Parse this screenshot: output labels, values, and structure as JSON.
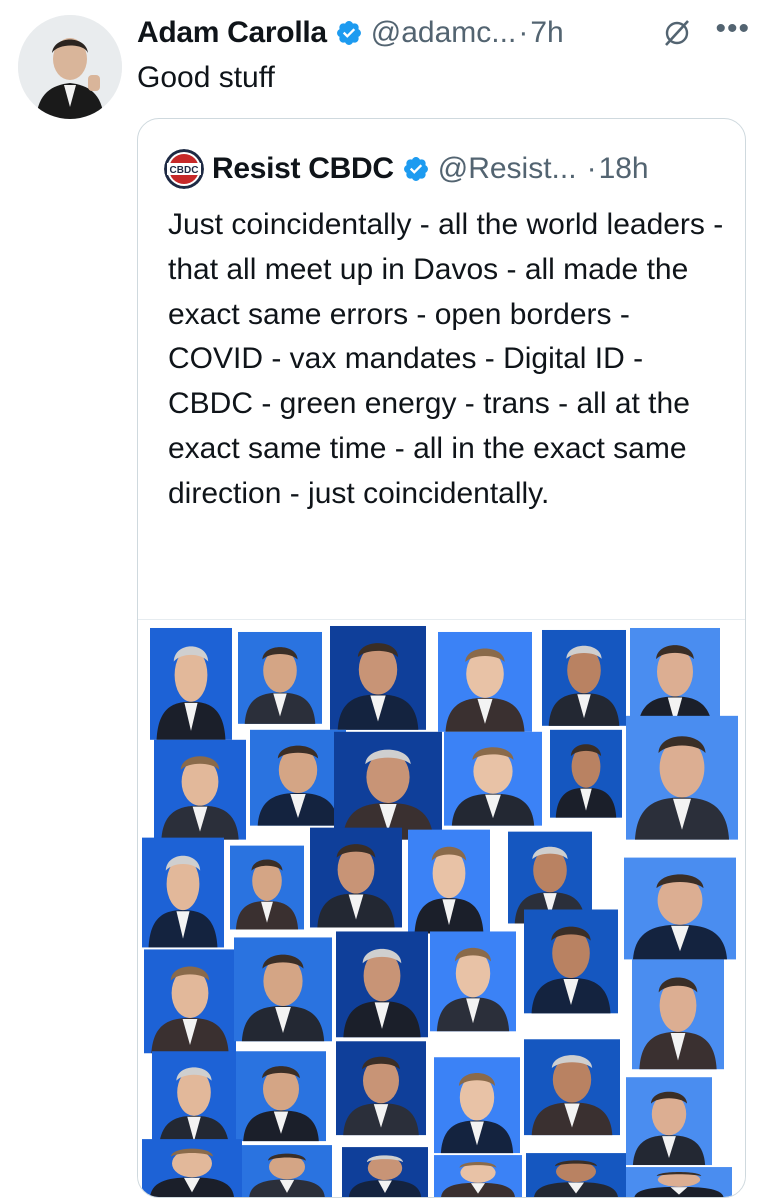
{
  "tweet": {
    "author_name": "Adam Carolla",
    "handle": "@adamc...",
    "separator": "·",
    "time": "7h",
    "text": "Good stuff",
    "more_icon": "more-dots-icon",
    "grok_icon": "grok-icon"
  },
  "quote": {
    "avatar_text": "CBDC",
    "author_name": "Resist CBDC",
    "handle": "@Resist...",
    "separator": "·",
    "time": "18h",
    "text": "Just coincidentally - all the world leaders - that all meet up in Davos - all made the exact same errors - open borders - COVID - vax mandates - Digital ID - CBDC - green energy - trans - all at the exact same time - all in the exact same direction - just coincidentally."
  },
  "colors": {
    "verified_blue": "#1d9bf0",
    "text_primary": "#0f1419",
    "text_secondary": "#536471",
    "wef_blue": "#1d62d6"
  }
}
